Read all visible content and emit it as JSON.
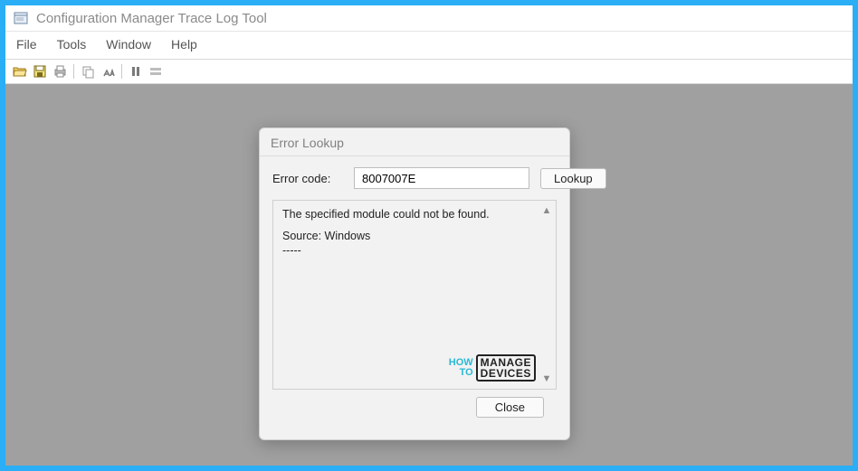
{
  "window": {
    "title": "Configuration Manager Trace Log Tool"
  },
  "menu": {
    "file": "File",
    "tools": "Tools",
    "window": "Window",
    "help": "Help"
  },
  "toolbar_icons": {
    "open": "open-folder-icon",
    "save": "save-icon",
    "print": "print-icon",
    "copy": "copy-icon",
    "find": "find-icon",
    "pause": "pause-icon",
    "highlight": "highlight-icon"
  },
  "dialog": {
    "title": "Error Lookup",
    "label": "Error code:",
    "value": "8007007E",
    "lookup_label": "Lookup",
    "result_message": "The specified module could not be found.",
    "result_source": "Source: Windows",
    "result_dashes": "-----",
    "close_label": "Close"
  },
  "watermark": {
    "how": "HOW",
    "to": "TO",
    "manage": "MANAGE",
    "devices": "DEVICES"
  }
}
